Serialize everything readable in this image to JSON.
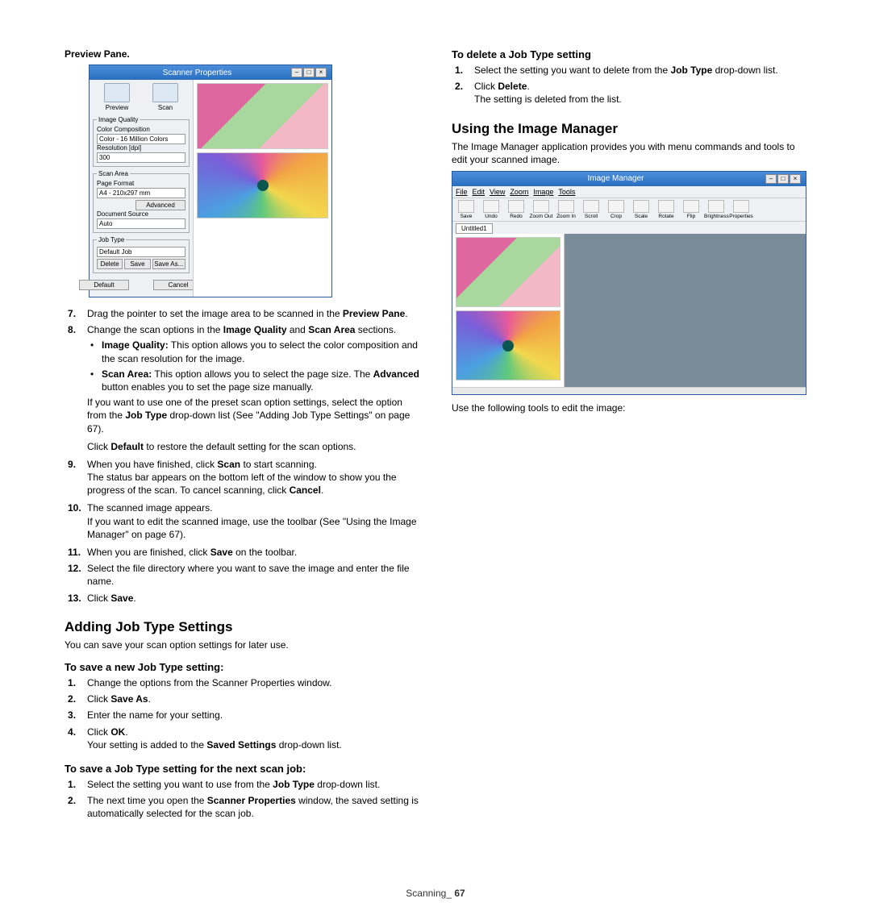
{
  "left": {
    "previewPaneLabel": "Preview Pane",
    "scannerWindow": {
      "title": "Scanner Properties",
      "previewBtn": "Preview",
      "scanBtn": "Scan",
      "imageQuality": {
        "legend": "Image Quality",
        "colorCompLabel": "Color Composition",
        "colorCompVal": "Color - 16 Million Colors",
        "resLabel": "Resolution [dpi]",
        "resVal": "300"
      },
      "scanArea": {
        "legend": "Scan Area",
        "pageFormatLabel": "Page Format",
        "pageFormatVal": "A4 - 210x297 mm",
        "advanced": "Advanced",
        "docSourceLabel": "Document Source",
        "docSourceVal": "Auto"
      },
      "jobType": {
        "legend": "Job Type",
        "val": "Default Job",
        "delete": "Delete",
        "save": "Save",
        "saveAs": "Save As..."
      },
      "defaultBtn": "Default",
      "cancelBtn": "Cancel"
    },
    "step7_a": "Drag the pointer to set the image area to be scanned in the ",
    "step7_b": "Preview Pane",
    "step8_a": "Change the scan options in the ",
    "step8_b": "Image Quality",
    "step8_c": " and ",
    "step8_d": "Scan Area",
    "step8_e": " sections.",
    "step8_iq_a": "Image Quality:",
    "step8_iq_b": "  This option allows you to select the color composition and the scan resolution for the image.",
    "step8_sa_a": "Scan Area:",
    "step8_sa_b": "  This option allows you to select the page size. The ",
    "step8_sa_c": "Advanced",
    "step8_sa_d": " button enables you to set the page size manually.",
    "step8_p1_a": "If you want to use one of the preset scan option settings, select the option from the ",
    "step8_p1_b": "Job Type",
    "step8_p1_c": " drop-down list (See \"Adding Job Type Settings\" on page 67).",
    "step8_p2_a": "Click ",
    "step8_p2_b": "Default",
    "step8_p2_c": " to restore the default setting for the scan options.",
    "step9_a": "When you have finished, click ",
    "step9_b": "Scan",
    "step9_c": " to start scanning.",
    "step9_p_a": "The status bar appears on the bottom left of the window to show you the progress of the scan. To cancel scanning, click ",
    "step9_p_b": "Cancel",
    "step10_a": "The scanned image appears.",
    "step10_p": "If you want to edit the scanned image, use the toolbar (See \"Using the Image Manager\" on page 67).",
    "step11_a": "When you are finished, click ",
    "step11_b": "Save",
    "step11_c": " on the toolbar.",
    "step12": "Select the file directory where you want to save the image and enter the file name.",
    "step13_a": "Click ",
    "step13_b": "Save",
    "h2_adding": "Adding Job Type Settings",
    "adding_p": "You can save your scan option settings for later use.",
    "h3_saveNew": "To save a new Job Type setting:",
    "sn1": "Change the options from the Scanner Properties window.",
    "sn2_a": "Click ",
    "sn2_b": "Save As",
    "sn3": "Enter the name for your setting.",
    "sn4_a": "Click ",
    "sn4_b": "OK",
    "sn4_p_a": "Your setting is added to the ",
    "sn4_p_b": "Saved Settings",
    "sn4_p_c": " drop-down list.",
    "h3_saveNext": "To save a Job Type setting for the next scan job:",
    "sx1_a": "Select the setting you want to use from the ",
    "sx1_b": "Job Type",
    "sx1_c": " drop-down list.",
    "sx2_a": "The next time you open the ",
    "sx2_b": "Scanner Properties",
    "sx2_c": " window, the saved setting is automatically selected for the scan job."
  },
  "right": {
    "h3_delete": "To delete a Job Type setting",
    "d1_a": "Select the setting you want to delete from the ",
    "d1_b": "Job Type",
    "d1_c": " drop-down list.",
    "d2_a": "Click ",
    "d2_b": "Delete",
    "d2_p": "The setting is deleted from the list.",
    "h2_im": "Using the Image Manager",
    "im_p": "The Image Manager application provides you with menu commands and tools to edit your scanned image.",
    "imWindow": {
      "title": "Image Manager",
      "menu": [
        "File",
        "Edit",
        "View",
        "Zoom",
        "Image",
        "Tools"
      ],
      "tools": [
        "Save",
        "Undo",
        "Redo",
        "Zoom Out",
        "Zoom In",
        "Scroll",
        "Crop",
        "Scale",
        "Rotate",
        "Flip",
        "Brightness",
        "Properties"
      ],
      "tab": "Untitled1"
    },
    "im_after": "Use the following tools to edit the image:"
  },
  "footer": {
    "section": "Scanning",
    "page": "67"
  }
}
